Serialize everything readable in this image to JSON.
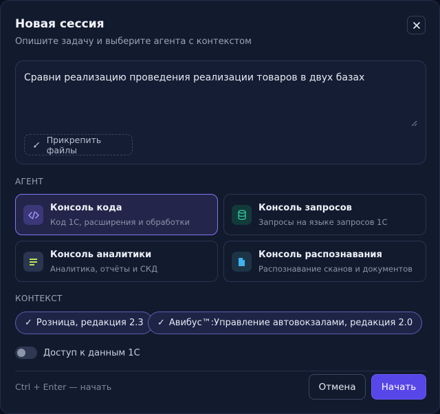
{
  "dialog": {
    "title": "Новая сессия",
    "subtitle": "Опишите задачу и выберите агента с контекстом",
    "close_icon": "close-icon"
  },
  "prompt": {
    "value": "Сравни реализацию проведения реализации товаров в двух базах",
    "attach_label": "Прикрепить файлы",
    "attach_icon": "paperclip-icon"
  },
  "agents": {
    "section_label": "АГЕНТ",
    "items": [
      {
        "name": "Консоль кода",
        "desc": "Код 1С, расширения и обработки",
        "icon": "code-icon",
        "selected": true,
        "color": "#8b7bf5"
      },
      {
        "name": "Консоль запросов",
        "desc": "Запросы на языке запросов 1С",
        "icon": "database-icon",
        "selected": false,
        "color": "#35c9a0"
      },
      {
        "name": "Консоль аналитики",
        "desc": "Аналитика, отчёты и СКД",
        "icon": "chart-icon",
        "selected": false,
        "color": "#b5e655"
      },
      {
        "name": "Консоль распознавания",
        "desc": "Распознавание сканов и документов",
        "icon": "document-icon",
        "selected": false,
        "color": "#3fb3f0"
      }
    ]
  },
  "context": {
    "section_label": "КОНТЕКСТ",
    "chips": [
      {
        "check": "✓",
        "label": "Розница, редакция 2.3"
      },
      {
        "check": "✓",
        "label": "Авибус™:Управление автовокзалами, редакция 2.0"
      }
    ]
  },
  "access": {
    "label": "Доступ к данным 1С",
    "enabled": false
  },
  "footer": {
    "hint": "Ctrl + Enter — начать",
    "cancel_label": "Отмена",
    "start_label": "Начать"
  },
  "colors": {
    "accent": "#5746e8",
    "selected_border": "#8577f0",
    "background": "#121a2e"
  }
}
